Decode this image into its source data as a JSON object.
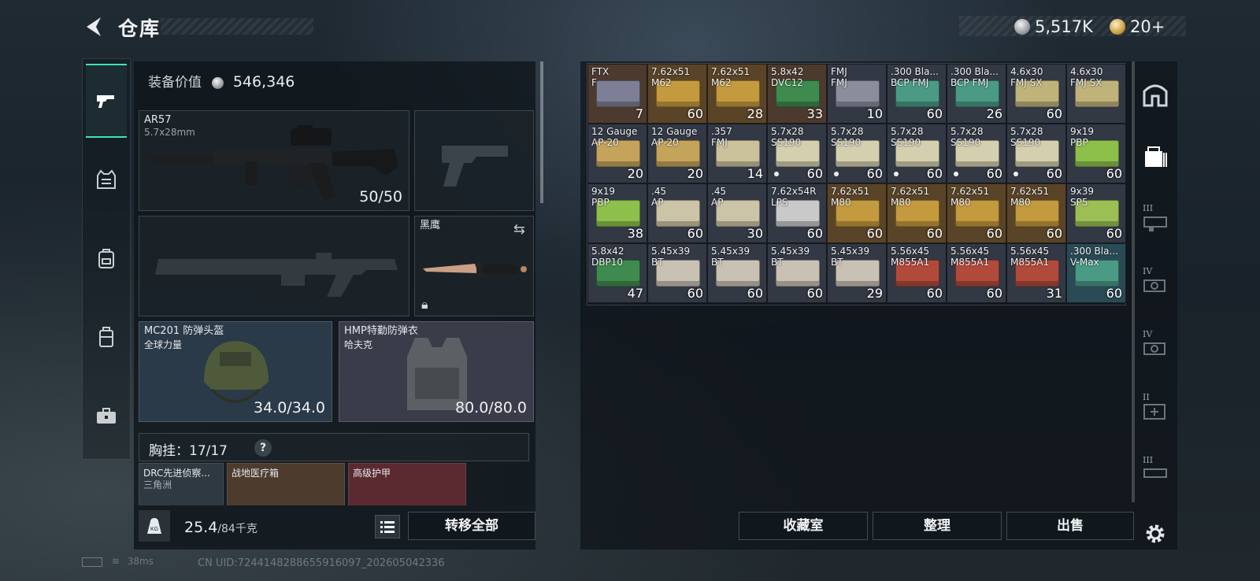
{
  "header": {
    "title": "仓库"
  },
  "currency": {
    "silver": "5,517K",
    "gold": "20+"
  },
  "left_nav": {
    "items": [
      "weapons-tab",
      "armor-tab",
      "backpack-tab",
      "rig-tab",
      "case-tab"
    ],
    "active": "weapons-tab"
  },
  "loadout": {
    "equip_value_label": "装备价值",
    "equip_value": "546,346",
    "primary": {
      "name": "AR57",
      "caliber": "5.7x28mm",
      "ammo": "50/50"
    },
    "melee": {
      "name": "黑鹰"
    },
    "helmet": {
      "name": "MC201 防弹头盔",
      "sub": "全球力量",
      "durability": "34.0/34.0"
    },
    "armor": {
      "name": "HMP特勤防弹衣",
      "sub": "哈夫克",
      "durability": "80.0/80.0"
    },
    "rig": {
      "label": "胸挂：",
      "capacity": "17/17",
      "help": "?"
    },
    "rig_items": [
      {
        "name": "DRC先进侦察...",
        "sub": "三角洲"
      },
      {
        "name": "战地医疗箱",
        "sub": ""
      },
      {
        "name": "高级护甲",
        "sub": ""
      }
    ],
    "weight": {
      "value": "25.4",
      "max": "/84千克"
    },
    "transfer_all": "转移全部"
  },
  "stash": {
    "items": [
      {
        "cal": [
          "FTX",
          "F"
        ],
        "count": "7",
        "color": "#7c7f95",
        "bg": "#4c3a2e"
      },
      {
        "cal": [
          "7.62x51",
          "M62"
        ],
        "count": "60",
        "color": "#c49a3e",
        "bg": "#5a4428"
      },
      {
        "cal": [
          "7.62x51",
          "M62"
        ],
        "count": "28",
        "color": "#c49a3e",
        "bg": "#5a4428"
      },
      {
        "cal": [
          "5.8x42",
          "DVC12"
        ],
        "count": "33",
        "color": "#3f8a4e",
        "bg": "#4c3a2e"
      },
      {
        "cal": [
          "FMJ",
          "FMJ"
        ],
        "count": "10",
        "color": "#8a8d9c",
        "bg": "#323844"
      },
      {
        "cal": [
          ".300 Bla...",
          "BCP FMJ"
        ],
        "count": "60",
        "color": "#4a9a86",
        "bg": "#323844"
      },
      {
        "cal": [
          ".300 Bla...",
          "BCP FMJ"
        ],
        "count": "26",
        "color": "#4a9a86",
        "bg": "#323844"
      },
      {
        "cal": [
          "4.6x30",
          "FMJ SX"
        ],
        "count": "60",
        "color": "#bfb37a",
        "bg": "#323844"
      },
      {
        "cal": [
          "4.6x30",
          "FMJ SX"
        ],
        "count": "",
        "color": "#bfb37a",
        "bg": "#323844"
      },
      {
        "cal": [
          "12 Gauge",
          "AP-20"
        ],
        "count": "20",
        "color": "#c4a35a",
        "bg": "#323844"
      },
      {
        "cal": [
          "12 Gauge",
          "AP-20"
        ],
        "count": "20",
        "color": "#c4a35a",
        "bg": "#323844"
      },
      {
        "cal": [
          ".357",
          "FMJ"
        ],
        "count": "14",
        "color": "#cbc29c",
        "bg": "#323844"
      },
      {
        "cal": [
          "5.7x28",
          "SS190"
        ],
        "count": "60",
        "color": "#d4cfae",
        "bg": "#323844",
        "dot": true
      },
      {
        "cal": [
          "5.7x28",
          "SS190"
        ],
        "count": "60",
        "color": "#d4cfae",
        "bg": "#323844",
        "dot": true
      },
      {
        "cal": [
          "5.7x28",
          "SS190"
        ],
        "count": "60",
        "color": "#d4cfae",
        "bg": "#323844",
        "dot": true
      },
      {
        "cal": [
          "5.7x28",
          "SS190"
        ],
        "count": "60",
        "color": "#d4cfae",
        "bg": "#323844",
        "dot": true
      },
      {
        "cal": [
          "5.7x28",
          "SS190"
        ],
        "count": "60",
        "color": "#d4cfae",
        "bg": "#323844",
        "dot": true
      },
      {
        "cal": [
          "9x19",
          "PBP"
        ],
        "count": "60",
        "color": "#8cc04a",
        "bg": "#323844"
      },
      {
        "cal": [
          "9x19",
          "PBP"
        ],
        "count": "38",
        "color": "#8cc04a",
        "bg": "#323844"
      },
      {
        "cal": [
          ".45",
          "AP"
        ],
        "count": "60",
        "color": "#ccc4a6",
        "bg": "#323844"
      },
      {
        "cal": [
          ".45",
          "AP"
        ],
        "count": "30",
        "color": "#ccc4a6",
        "bg": "#323844"
      },
      {
        "cal": [
          "7.62x54R",
          "LPS"
        ],
        "count": "60",
        "color": "#c9c9c9",
        "bg": "#323844"
      },
      {
        "cal": [
          "7.62x51",
          "M80"
        ],
        "count": "60",
        "color": "#c49a3e",
        "bg": "#5a4428"
      },
      {
        "cal": [
          "7.62x51",
          "M80"
        ],
        "count": "60",
        "color": "#c49a3e",
        "bg": "#5a4428"
      },
      {
        "cal": [
          "7.62x51",
          "M80"
        ],
        "count": "60",
        "color": "#c49a3e",
        "bg": "#5a4428"
      },
      {
        "cal": [
          "7.62x51",
          "M80"
        ],
        "count": "60",
        "color": "#c49a3e",
        "bg": "#5a4428"
      },
      {
        "cal": [
          "9x39",
          "SP5"
        ],
        "count": "60",
        "color": "#9bbf55",
        "bg": "#323844"
      },
      {
        "cal": [
          "5.8x42",
          "DBP10"
        ],
        "count": "47",
        "color": "#3f8a4e",
        "bg": "#323844"
      },
      {
        "cal": [
          "5.45x39",
          "BT"
        ],
        "count": "60",
        "color": "#c9c2b4",
        "bg": "#323844"
      },
      {
        "cal": [
          "5.45x39",
          "BT"
        ],
        "count": "60",
        "color": "#c9c2b4",
        "bg": "#323844"
      },
      {
        "cal": [
          "5.45x39",
          "BT"
        ],
        "count": "60",
        "color": "#c9c2b4",
        "bg": "#323844"
      },
      {
        "cal": [
          "5.45x39",
          "BT"
        ],
        "count": "29",
        "color": "#c9c2b4",
        "bg": "#323844"
      },
      {
        "cal": [
          "5.56x45",
          "M855A1"
        ],
        "count": "60",
        "color": "#b24a3c",
        "bg": "#323844"
      },
      {
        "cal": [
          "5.56x45",
          "M855A1"
        ],
        "count": "60",
        "color": "#b24a3c",
        "bg": "#323844"
      },
      {
        "cal": [
          "5.56x45",
          "M855A1"
        ],
        "count": "31",
        "color": "#b24a3c",
        "bg": "#323844"
      },
      {
        "cal": [
          ".300 Bla...",
          "V-Max"
        ],
        "count": "60",
        "color": "#4a9a86",
        "bg": "#2a4a55"
      }
    ],
    "buttons": {
      "collection": "收藏室",
      "sort": "整理",
      "sell": "出售"
    }
  },
  "right_tabs": [
    "safe-icon",
    "ammo-box-icon",
    "III",
    "IV",
    "IV",
    "II",
    "III"
  ],
  "status": {
    "ping": "38ms",
    "uid": "CN UID:7244148288655916097_202605042336"
  }
}
